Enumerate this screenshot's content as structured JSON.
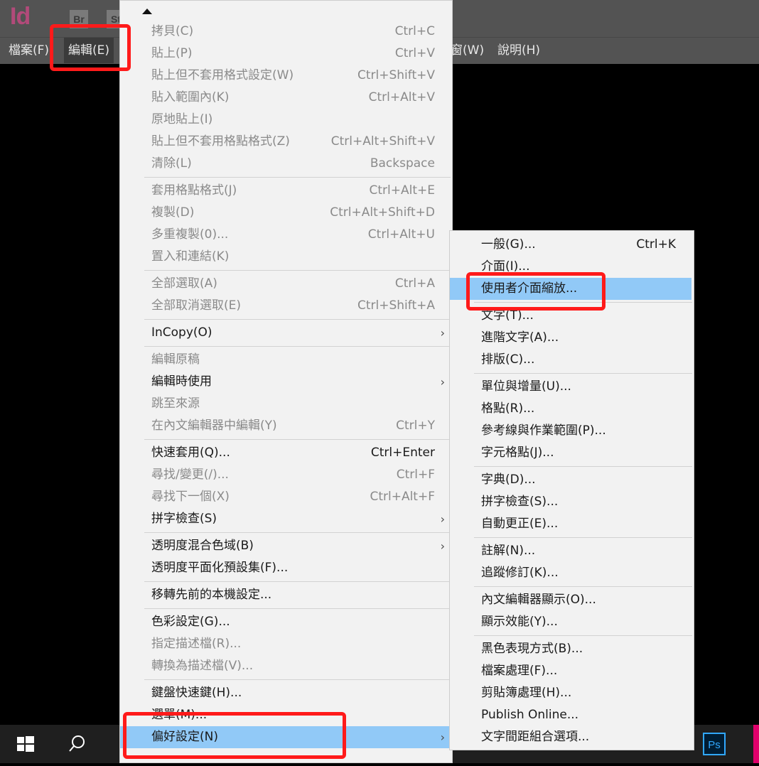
{
  "app": {
    "logo": "Id",
    "bridge": "Br",
    "stock": "St"
  },
  "menubar": {
    "file": "檔案(F)",
    "edit": "編輯(E)",
    "window": "窗(W)",
    "help": "說明(H)"
  },
  "edit_menu": [
    {
      "label": "拷貝(C)",
      "shortcut": "Ctrl+C",
      "disabled": true
    },
    {
      "label": "貼上(P)",
      "shortcut": "Ctrl+V",
      "disabled": true
    },
    {
      "label": "貼上但不套用格式設定(W)",
      "shortcut": "Ctrl+Shift+V",
      "disabled": true
    },
    {
      "label": "貼入範圍內(K)",
      "shortcut": "Ctrl+Alt+V",
      "disabled": true
    },
    {
      "label": "原地貼上(I)",
      "shortcut": "",
      "disabled": true
    },
    {
      "label": "貼上但不套用格點格式(Z)",
      "shortcut": "Ctrl+Alt+Shift+V",
      "disabled": true
    },
    {
      "label": "清除(L)",
      "shortcut": "Backspace",
      "disabled": true
    },
    {
      "label": "套用格點格式(J)",
      "shortcut": "Ctrl+Alt+E",
      "disabled": true
    },
    {
      "label": "複製(D)",
      "shortcut": "Ctrl+Alt+Shift+D",
      "disabled": true
    },
    {
      "label": "多重複製(0)...",
      "shortcut": "Ctrl+Alt+U",
      "disabled": true
    },
    {
      "label": "置入和連結(K)",
      "shortcut": "",
      "disabled": true
    },
    {
      "label": "全部選取(A)",
      "shortcut": "Ctrl+A",
      "disabled": true
    },
    {
      "label": "全部取消選取(E)",
      "shortcut": "Ctrl+Shift+A",
      "disabled": true
    },
    {
      "label": "InCopy(O)",
      "shortcut": "",
      "disabled": false,
      "submenu": true
    },
    {
      "label": "編輯原稿",
      "shortcut": "",
      "disabled": true
    },
    {
      "label": "編輯時使用",
      "shortcut": "",
      "disabled": false,
      "submenu": true
    },
    {
      "label": "跳至來源",
      "shortcut": "",
      "disabled": true
    },
    {
      "label": "在內文編輯器中編輯(Y)",
      "shortcut": "Ctrl+Y",
      "disabled": true
    },
    {
      "label": "快速套用(Q)...",
      "shortcut": "Ctrl+Enter",
      "disabled": false
    },
    {
      "label": "尋找/變更(/)...",
      "shortcut": "Ctrl+F",
      "disabled": true
    },
    {
      "label": "尋找下一個(X)",
      "shortcut": "Ctrl+Alt+F",
      "disabled": true
    },
    {
      "label": "拼字檢查(S)",
      "shortcut": "",
      "disabled": false,
      "submenu": true
    },
    {
      "label": "透明度混合色域(B)",
      "shortcut": "",
      "disabled": false,
      "submenu": true
    },
    {
      "label": "透明度平面化預設集(F)...",
      "shortcut": "",
      "disabled": false
    },
    {
      "label": "移轉先前的本機設定...",
      "shortcut": "",
      "disabled": false
    },
    {
      "label": "色彩設定(G)...",
      "shortcut": "",
      "disabled": false
    },
    {
      "label": "指定描述檔(R)...",
      "shortcut": "",
      "disabled": true
    },
    {
      "label": "轉換為描述檔(V)...",
      "shortcut": "",
      "disabled": true
    },
    {
      "label": "鍵盤快速鍵(H)...",
      "shortcut": "",
      "disabled": false
    },
    {
      "label": "選單(M)...",
      "shortcut": "",
      "disabled": false
    },
    {
      "label": "偏好設定(N)",
      "shortcut": "",
      "disabled": false,
      "submenu": true,
      "highlighted": true
    }
  ],
  "prefs_menu": [
    {
      "label": "一般(G)...",
      "shortcut": "Ctrl+K"
    },
    {
      "label": "介面(I)...",
      "shortcut": ""
    },
    {
      "label": "使用者介面縮放...",
      "shortcut": "",
      "highlighted": true
    },
    {
      "label": "文字(T)...",
      "shortcut": ""
    },
    {
      "label": "進階文字(A)...",
      "shortcut": ""
    },
    {
      "label": "排版(C)...",
      "shortcut": ""
    },
    {
      "label": "單位與增量(U)...",
      "shortcut": ""
    },
    {
      "label": "格點(R)...",
      "shortcut": ""
    },
    {
      "label": "參考線與作業範圍(P)...",
      "shortcut": ""
    },
    {
      "label": "字元格點(J)...",
      "shortcut": ""
    },
    {
      "label": "字典(D)...",
      "shortcut": ""
    },
    {
      "label": "拼字檢查(S)...",
      "shortcut": ""
    },
    {
      "label": "自動更正(E)...",
      "shortcut": ""
    },
    {
      "label": "註解(N)...",
      "shortcut": ""
    },
    {
      "label": "追蹤修訂(K)...",
      "shortcut": ""
    },
    {
      "label": "內文編輯器顯示(O)...",
      "shortcut": ""
    },
    {
      "label": "顯示效能(Y)...",
      "shortcut": ""
    },
    {
      "label": "黑色表現方式(B)...",
      "shortcut": ""
    },
    {
      "label": "檔案處理(F)...",
      "shortcut": ""
    },
    {
      "label": "剪貼簿處理(H)...",
      "shortcut": ""
    },
    {
      "label": "Publish Online...",
      "shortcut": ""
    },
    {
      "label": "文字間距組合選項...",
      "shortcut": ""
    }
  ],
  "submenu_arrow": "›",
  "taskbar": {
    "ps_label": "Ps",
    "icons": [
      "windows-start-icon",
      "search-icon",
      "photoshop-icon"
    ]
  }
}
